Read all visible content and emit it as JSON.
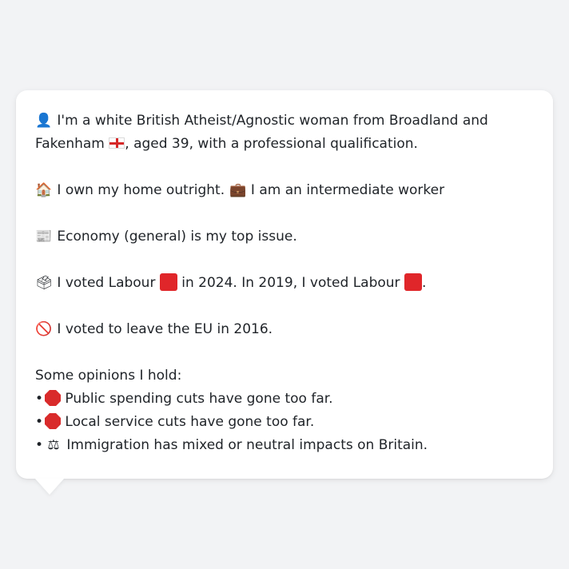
{
  "profile": {
    "line1a": " I'm a white British Atheist/Agnostic woman from Broadland and",
    "line1b_pre": "Fakenham ",
    "line1b_post": ", aged 39, with a professional qualification.",
    "home": " I own my home outright. ",
    "work": " I am an intermediate worker",
    "issue": " Economy (general) is my top issue.",
    "vote_a": " I voted Labour ",
    "vote_b": " in 2024. In 2019, I voted Labour ",
    "vote_c": ".",
    "eu": " I voted to leave the EU in 2016.",
    "opinions_heading": "Some opinions I hold:",
    "opinions": [
      " Public spending cuts have gone too far.",
      " Local service cuts have gone too far.",
      " Immigration has mixed or neutral impacts on Britain."
    ],
    "bullet": "•"
  },
  "icons": {
    "person": "person-icon",
    "house": "house-icon",
    "briefcase": "briefcase-icon",
    "newspaper": "newspaper-icon",
    "ballot": "ballot-box-icon",
    "prohibited": "prohibited-icon",
    "stop": "stop-sign-icon",
    "scales": "scales-icon",
    "flag": "england-flag-icon"
  },
  "colors": {
    "labour": "#e0262a",
    "background": "#f2f3f5",
    "bubble": "#ffffff"
  }
}
